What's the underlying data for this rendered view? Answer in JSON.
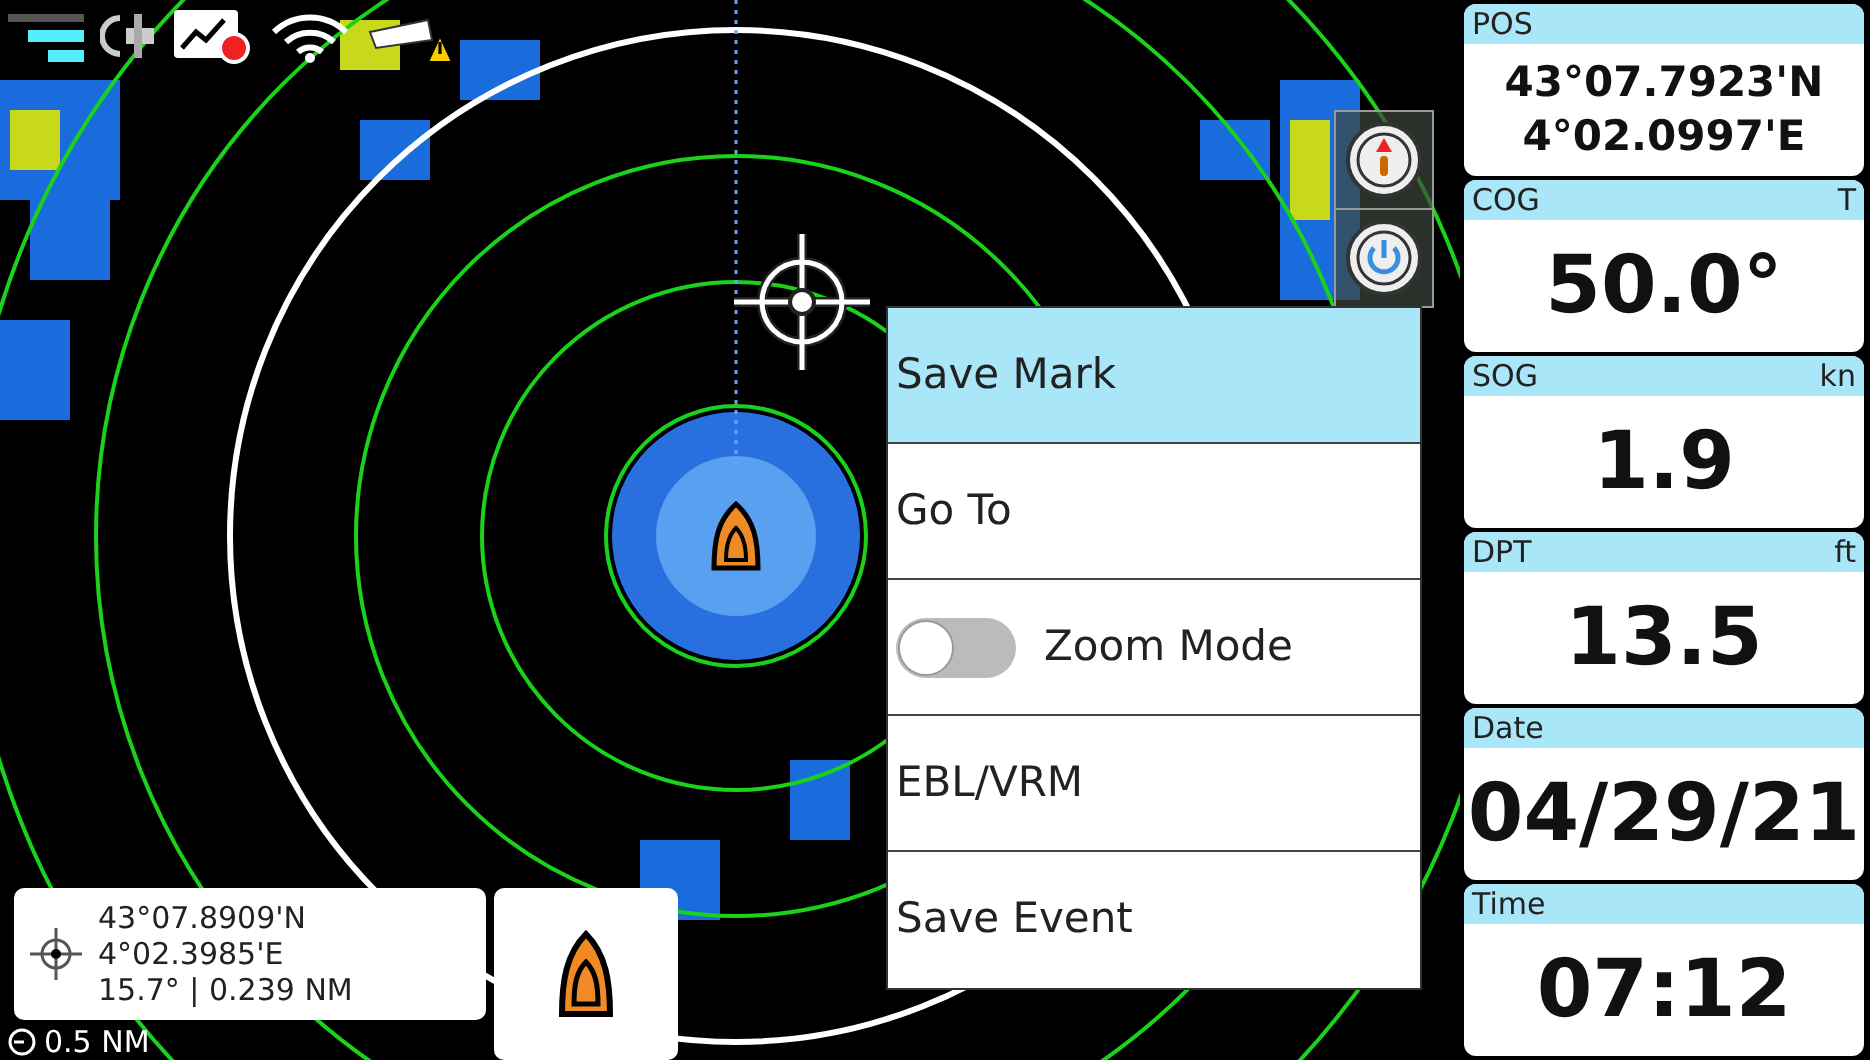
{
  "menu": [
    {
      "kind": "button",
      "label": "Save Mark",
      "selected": true
    },
    {
      "kind": "button",
      "label": "Go To",
      "selected": false
    },
    {
      "kind": "toggle",
      "label": "Zoom Mode",
      "selected": false,
      "on": false
    },
    {
      "kind": "button",
      "label": "EBL/VRM",
      "selected": false
    },
    {
      "kind": "button",
      "label": "Save Event",
      "selected": false
    }
  ],
  "cursor_info": {
    "lines": [
      "43°07.8909'N",
      "4°02.3985'E",
      "15.7° | 0.239 NM"
    ]
  },
  "range": "0.5 NM",
  "data_panels": [
    {
      "label": "POS",
      "values": [
        "43°07.7923'N",
        "4°02.0997'E"
      ]
    },
    {
      "label": "COG",
      "unit": "T",
      "values": [
        "50.0°"
      ]
    },
    {
      "label": "SOG",
      "unit": "kn",
      "values": [
        "1.9"
      ]
    },
    {
      "label": "DPT",
      "unit": "ft",
      "values": [
        "13.5"
      ]
    },
    {
      "label": "Date",
      "values": [
        "04/29/21"
      ]
    },
    {
      "label": "Time",
      "values": [
        "07:12"
      ]
    }
  ]
}
